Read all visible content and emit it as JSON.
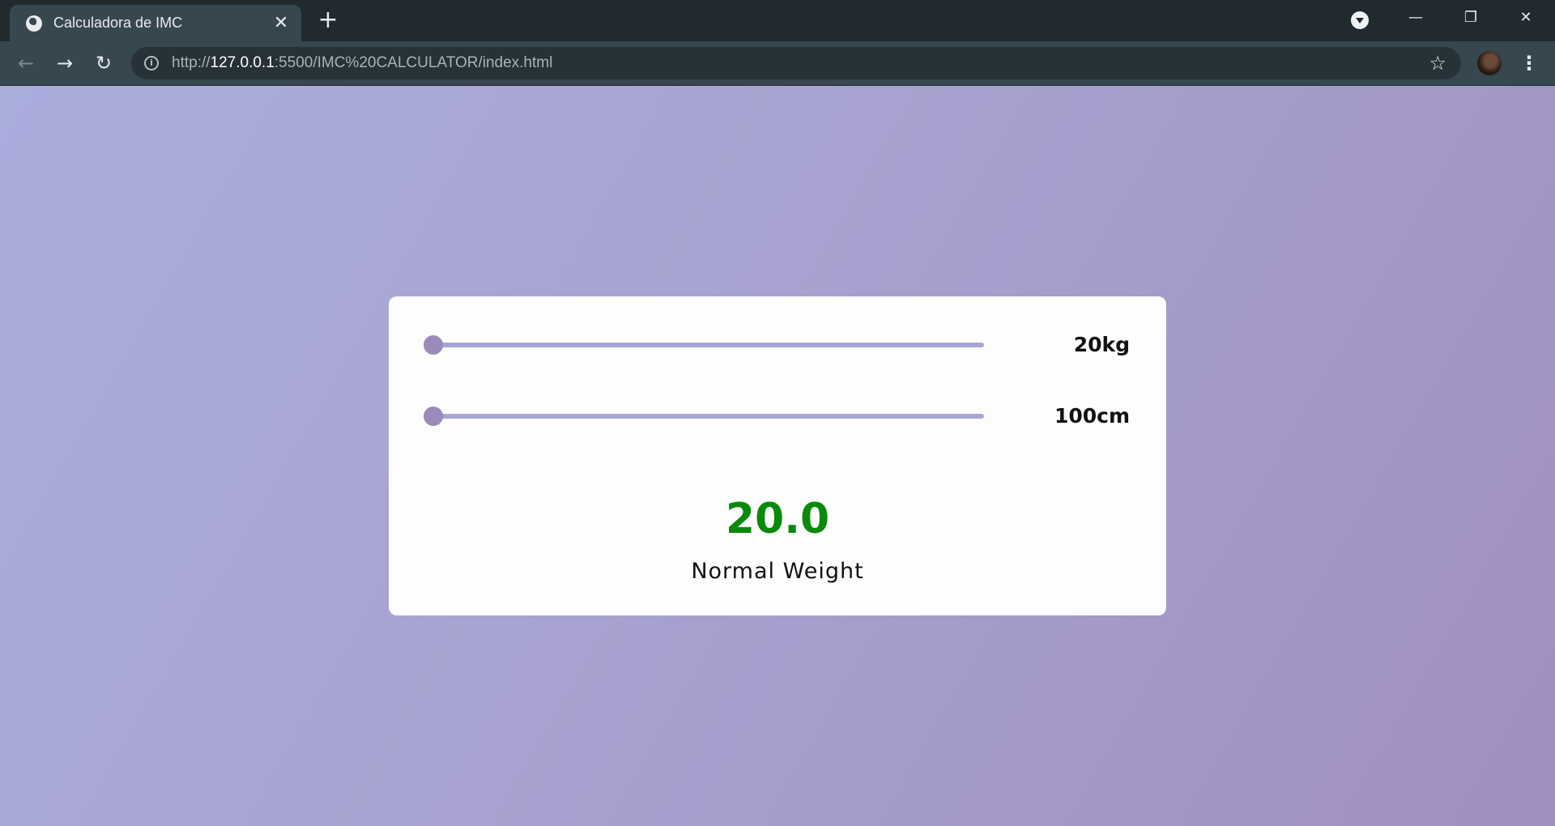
{
  "browser": {
    "tab_title": "Calculadora de IMC",
    "tab_close": "✕",
    "new_tab": "+",
    "url_scheme": "http://",
    "url_host": "127.0.0.1",
    "url_rest": ":5500/IMC%20CALCULATOR/index.html",
    "window_controls": {
      "minimize": "—",
      "restore": "❐",
      "close": "✕"
    },
    "nav": {
      "back": "←",
      "forward": "→",
      "reload": "↻"
    },
    "star": "☆",
    "menu": "⋮",
    "info": "i"
  },
  "calculator": {
    "weight": {
      "label": "20kg",
      "value": 20,
      "min": 20,
      "max": 200
    },
    "height": {
      "label": "100cm",
      "value": 100,
      "min": 100,
      "max": 250
    },
    "bmi_value": "20.0",
    "bmi_status": "Normal Weight",
    "bmi_color": "#0a8a0a"
  },
  "colors": {
    "track": "#a8a7d4",
    "thumb": "#9b8bb8",
    "chrome_dark": "#202a2f",
    "chrome": "#37474f"
  }
}
